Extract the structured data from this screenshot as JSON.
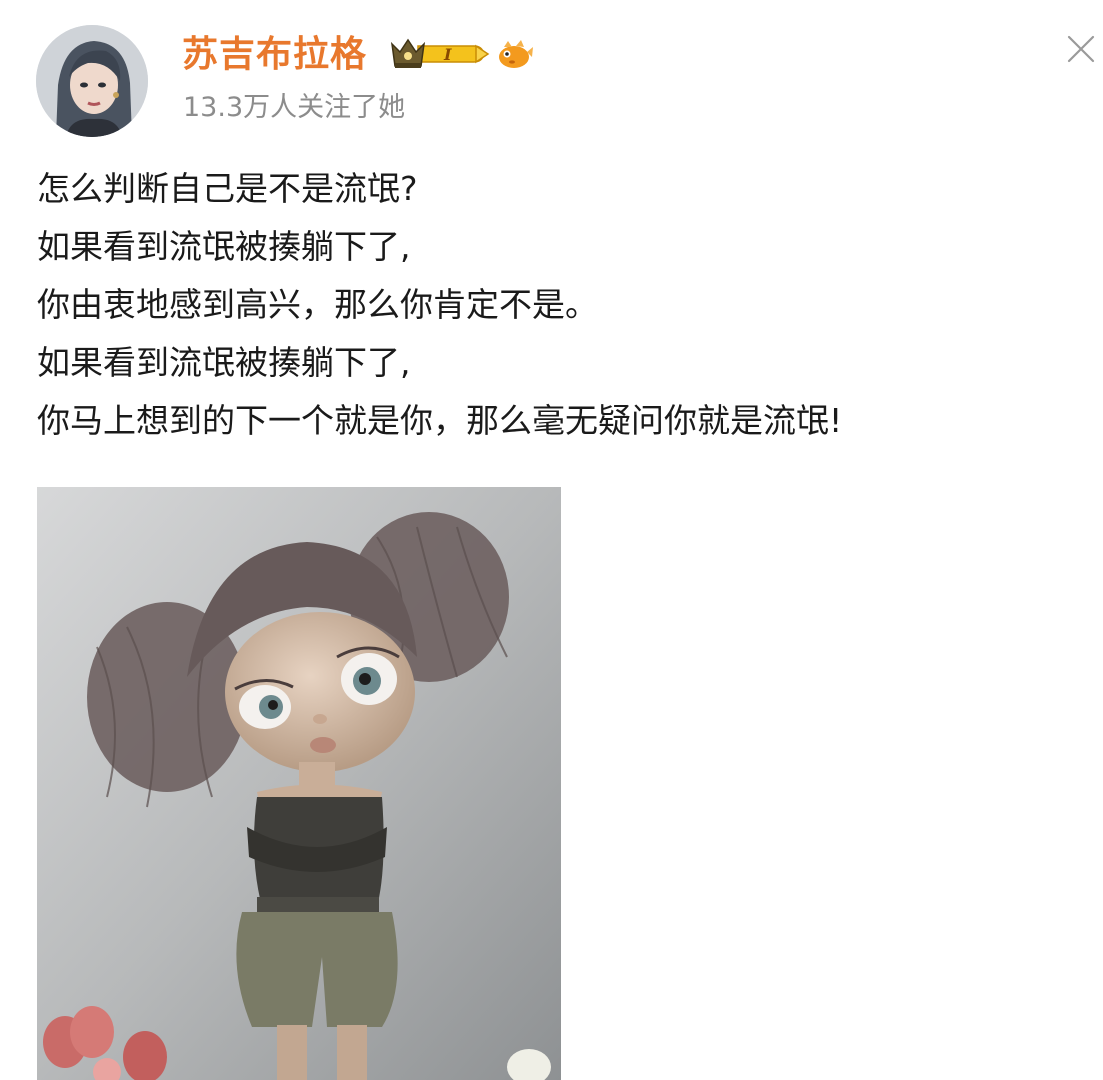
{
  "post": {
    "author": {
      "name": "苏吉布拉格",
      "followers_text": "13.3万人关注了她",
      "vip_level": "I"
    },
    "content_lines": [
      "怎么判断自己是不是流氓?",
      "如果看到流氓被揍躺下了,",
      "你由衷地感到高兴，那么你肯定不是。",
      "如果看到流氓被揍躺下了,",
      "你马上想到的下一个就是你，那么毫无疑问你就是流氓!"
    ],
    "image": {
      "description_icon": "cartoon-girl-image"
    }
  },
  "colors": {
    "username": "#e8782d",
    "followers": "#8c8c8c",
    "text": "#1a1a1a",
    "badge_gold": "#f4c21c"
  },
  "icons": {
    "close": "close-icon",
    "badge": "vip-crown-badge",
    "fish": "fish-icon"
  }
}
